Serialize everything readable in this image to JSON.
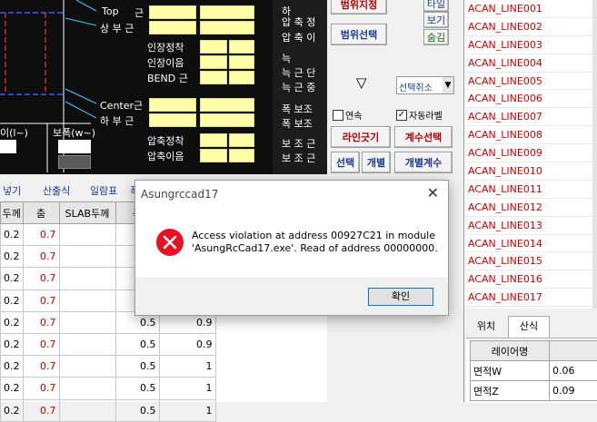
{
  "canvas": {
    "labels": [
      "Top",
      "근",
      "상 부 근",
      "인장정착",
      "인장이음",
      "BEND 근",
      "Center근",
      "하 부 근",
      "압축정착",
      "압축이음"
    ],
    "left_label": "이(l~)",
    "bottom_label": "보폭(w~)",
    "right_column": [
      "하",
      "압 축 정",
      "압 축 이",
      "늑",
      "늑 근 단",
      "늑 근 중",
      "폭 보조",
      "폭 보조",
      "보 조 근",
      "보 조 근"
    ]
  },
  "buttons": {
    "range_setting": "범위지정",
    "range_select": "범위선택",
    "triangle": "▽",
    "small_1": "타일",
    "small_2": "보기",
    "small_3": "숨김",
    "deselect": "선택취소",
    "continuous": "연속",
    "auto_label": "자동라벨",
    "line_draw": "라인긋기",
    "count_select": "계수선택",
    "select": "선택",
    "individual": "개별",
    "individual_count": "개별계수"
  },
  "list": {
    "items": [
      "ACAN_LINE001",
      "ACAN_LINE002",
      "ACAN_LINE003",
      "ACAN_LINE004",
      "ACAN_LINE005",
      "ACAN_LINE006",
      "ACAN_LINE007",
      "ACAN_LINE008",
      "ACAN_LINE009",
      "ACAN_LINE010",
      "ACAN_LINE011",
      "ACAN_LINE012",
      "ACAN_LINE013",
      "ACAN_LINE014",
      "ACAN_LINE015",
      "ACAN_LINE016",
      "ACAN_LINE017"
    ]
  },
  "props": {
    "tabs": [
      "위치",
      "산식"
    ],
    "header": "레이어명",
    "rows": [
      {
        "name": "면적W",
        "value": "0.06"
      },
      {
        "name": "면적Z",
        "value": "0.09"
      }
    ]
  },
  "toolbar": {
    "items": [
      "넣기",
      "산출식",
      "일람표",
      "폭"
    ]
  },
  "grid": {
    "headers": [
      "두께",
      "춤",
      "SLAB두께",
      "폭",
      ""
    ],
    "rows": [
      [
        "0.2",
        "0.7",
        "",
        "",
        ""
      ],
      [
        "0.2",
        "0.7",
        "",
        "",
        ""
      ],
      [
        "0.2",
        "0.7",
        "",
        "",
        ""
      ],
      [
        "0.2",
        "0.7",
        "",
        "",
        ""
      ],
      [
        "0.2",
        "0.7",
        "",
        "0.5",
        "0.9"
      ],
      [
        "0.2",
        "0.7",
        "",
        "0.5",
        "0.9"
      ],
      [
        "0.2",
        "0.7",
        "",
        "0.5",
        "1"
      ],
      [
        "0.2",
        "0.7",
        "",
        "0.5",
        "1"
      ],
      [
        "0.2",
        "0.7",
        "",
        "0.5",
        "1"
      ]
    ]
  },
  "dialog": {
    "title": "Asungrccad17",
    "message_line1": "Access violation at address 00927C21 in module",
    "message_line2": "'AsungRcCad17.exe'. Read of address 00000000.",
    "ok_label": "확인",
    "error_color": "#e81123"
  }
}
